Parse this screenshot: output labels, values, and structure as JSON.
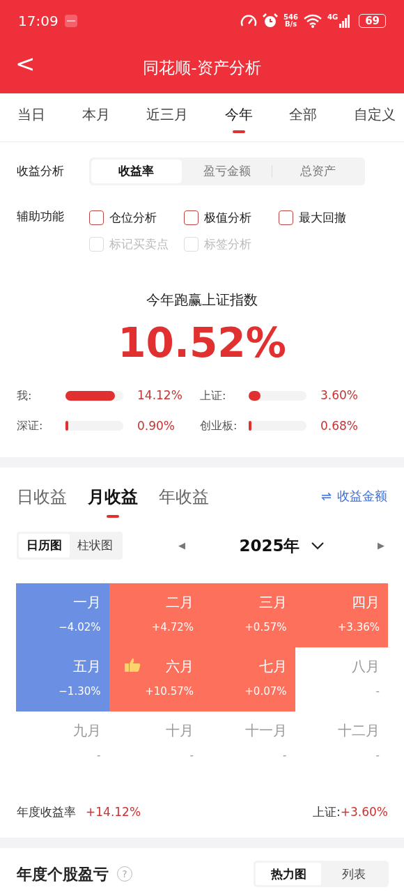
{
  "status_bar": {
    "time": "17:09",
    "net_speed": [
      "546",
      "B/s"
    ],
    "network": "4G",
    "battery": "69"
  },
  "header": {
    "back": "<",
    "title": "同花顺-资产分析"
  },
  "period_tabs": [
    {
      "label": "当日",
      "selected": false
    },
    {
      "label": "本月",
      "selected": false
    },
    {
      "label": "近三月",
      "selected": false
    },
    {
      "label": "今年",
      "selected": true
    },
    {
      "label": "全部",
      "selected": false
    },
    {
      "label": "自定义",
      "selected": false
    }
  ],
  "return_analysis": {
    "label": "收益分析",
    "options": [
      {
        "label": "收益率",
        "selected": true
      },
      {
        "label": "盈亏金额",
        "selected": false
      },
      {
        "label": "总资产",
        "selected": false
      }
    ]
  },
  "aux_functions": {
    "label": "辅助功能",
    "items": [
      {
        "label": "仓位分析",
        "checked": false,
        "disabled": false
      },
      {
        "label": "极值分析",
        "checked": false,
        "disabled": false
      },
      {
        "label": "最大回撤",
        "checked": false,
        "disabled": false
      },
      {
        "label": "标记买卖点",
        "checked": false,
        "disabled": true
      },
      {
        "label": "标签分析",
        "checked": false,
        "disabled": true
      }
    ]
  },
  "summary": {
    "headline": "今年跑赢上证指数",
    "value": "10.52%"
  },
  "comparisons": [
    {
      "name": "我:",
      "level": 0.86,
      "reading": "14.12%"
    },
    {
      "name": "上证:",
      "level": 0.2,
      "reading": "3.60%"
    },
    {
      "name": "深证:",
      "level": 0.04,
      "reading": "0.90%"
    },
    {
      "name": "创业板:",
      "level": 0.03,
      "reading": "0.68%"
    }
  ],
  "earnings_tabs": [
    {
      "label": "日收益",
      "selected": false
    },
    {
      "label": "月收益",
      "selected": true
    },
    {
      "label": "年收益",
      "selected": false
    }
  ],
  "amount_toggle": {
    "icon": "⇌",
    "label": "收益金额"
  },
  "view_toggle": [
    {
      "label": "日历图",
      "selected": true
    },
    {
      "label": "柱状图",
      "selected": false
    }
  ],
  "year_picker": {
    "prev": "◀",
    "year": "2025年",
    "next": "▶"
  },
  "months": [
    {
      "name": "一月",
      "value": "−4.02%",
      "kind": "loss",
      "best": false
    },
    {
      "name": "二月",
      "value": "+4.72%",
      "kind": "gain",
      "best": false
    },
    {
      "name": "三月",
      "value": "+0.57%",
      "kind": "gain",
      "best": false
    },
    {
      "name": "四月",
      "value": "+3.36%",
      "kind": "gain",
      "best": false
    },
    {
      "name": "五月",
      "value": "−1.30%",
      "kind": "loss",
      "best": false
    },
    {
      "name": "六月",
      "value": "+10.57%",
      "kind": "gain",
      "best": true
    },
    {
      "name": "七月",
      "value": "+0.07%",
      "kind": "gain",
      "best": false
    },
    {
      "name": "八月",
      "value": "-",
      "kind": "none",
      "best": false
    },
    {
      "name": "九月",
      "value": "-",
      "kind": "none",
      "best": false
    },
    {
      "name": "十月",
      "value": "-",
      "kind": "none",
      "best": false
    },
    {
      "name": "十一月",
      "value": "-",
      "kind": "none",
      "best": false
    },
    {
      "name": "十二月",
      "value": "-",
      "kind": "none",
      "best": false
    }
  ],
  "annual": {
    "label": "年度收益率",
    "value": "+14.12%",
    "index_label": "上证:",
    "index_value": "+3.60%"
  },
  "stock_pnl": {
    "title": "年度个股盈亏",
    "help": "?",
    "views": [
      {
        "label": "热力图",
        "selected": true
      },
      {
        "label": "列表",
        "selected": false
      }
    ]
  }
}
